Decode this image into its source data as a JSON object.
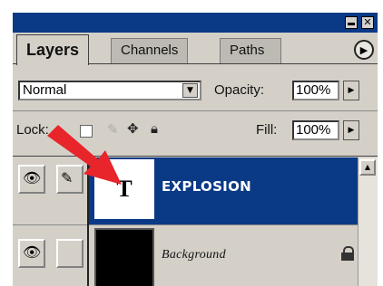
{
  "window": {
    "minimize_glyph": "",
    "close_glyph": "✕"
  },
  "tabs": [
    {
      "label": "Layers",
      "active": true
    },
    {
      "label": "Channels",
      "active": false
    },
    {
      "label": "Paths",
      "active": false
    }
  ],
  "blend": {
    "mode": "Normal",
    "opacity_label": "Opacity:",
    "opacity_value": "100%"
  },
  "lock": {
    "label": "Lock:",
    "fill_label": "Fill:",
    "fill_value": "100%"
  },
  "layers": [
    {
      "name": "EXPLOSION",
      "thumb_glyph": "T",
      "selected": true
    },
    {
      "name": "Background",
      "locked": true
    }
  ],
  "icons": {
    "menu": "triangle-right-icon",
    "dropdown": "triangle-down-icon",
    "stepper": "triangle-right-icon",
    "eye": "eye-icon",
    "brush": "brush-icon",
    "move": "move-arrows-icon",
    "lock": "padlock-icon"
  },
  "colors": {
    "title_bar": "#0a3a86",
    "panel_gray": "#d4d0c8",
    "selected_layer": "#0a3a86",
    "annotation_arrow": "#e8252b"
  }
}
